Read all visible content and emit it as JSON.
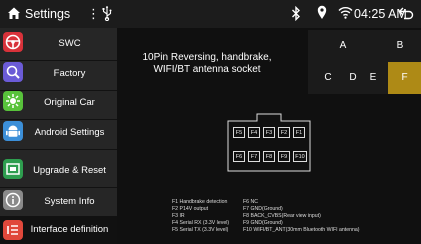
{
  "statusbar": {
    "title": "Settings",
    "menu_glyph": "⋮",
    "time": "04:25 AM",
    "icons": [
      "home-icon",
      "usb-icon",
      "bluetooth-icon",
      "location-icon",
      "wifi-icon",
      "back-icon"
    ]
  },
  "sidebar": {
    "items": [
      {
        "label": "SWC",
        "icon": "steering-wheel-icon",
        "color": "#d8323a"
      },
      {
        "label": "Factory",
        "icon": "factory-icon",
        "color": "#6b5bd6"
      },
      {
        "label": "Original Car",
        "icon": "original-car-icon",
        "color": "#58c23b"
      },
      {
        "label": "Android Settings",
        "icon": "android-icon",
        "color": "#3c8fd8"
      },
      {
        "label": "Upgrade & Reset",
        "icon": "upgrade-icon",
        "color": "#2e9e4f"
      },
      {
        "label": "System Info",
        "icon": "info-icon",
        "color": "#8a8a8a"
      },
      {
        "label": "Interface definition",
        "icon": "interface-list-icon",
        "color": "#e0483b"
      }
    ]
  },
  "main": {
    "title_line1": "10Pin Reversing, handbrake,",
    "title_line2": "WIFI/BT antenna socket"
  },
  "tabs": {
    "items": [
      "A",
      "B",
      "C",
      "D",
      "E",
      "F"
    ],
    "active": "F",
    "active_color": "#ae8a16"
  },
  "connector": {
    "top_row": [
      "F5",
      "F4",
      "F3",
      "F2",
      "F1"
    ],
    "bottom_row": [
      "F6",
      "F7",
      "F8",
      "F9",
      "F10"
    ]
  },
  "legend": {
    "left": [
      "F1 Handbrake detection",
      "F2 P14V output",
      "F3 IR",
      "F4 Serial RX (3.3V level)",
      "F5 Serial TX (3.3V level)"
    ],
    "right": [
      "F6 NC",
      "F7 GND(Ground)",
      "F8 BACK_CVBS(Rear view input)",
      "F9 GND(Ground)",
      "F10 WIFI/BT_ANT(30mm Bluetooth WIFI antenna)"
    ]
  }
}
